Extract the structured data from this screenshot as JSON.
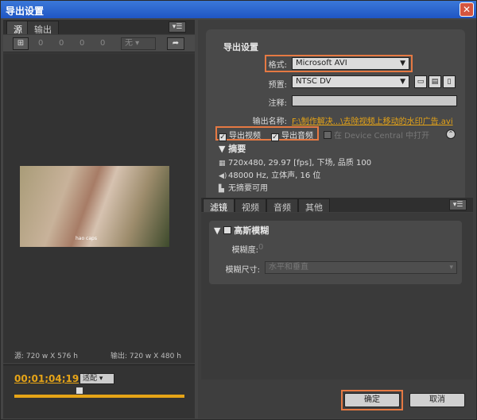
{
  "window": {
    "title": "导出设置",
    "close_glyph": "✕"
  },
  "left": {
    "tabs": [
      {
        "label": "源"
      },
      {
        "label": "输出"
      }
    ],
    "crop_values": [
      "0",
      "0",
      "0",
      "0"
    ],
    "crop_preset": "无",
    "source_size": "源: 720 w X 576 h",
    "output_size": "输出: 720 w X 480 h",
    "timecode": "00;01;04;19",
    "fit_label": "适配",
    "video_watermark_text": "hao caps"
  },
  "export": {
    "section_title": "导出设置",
    "format_label": "格式:",
    "format_value": "Microsoft AVI",
    "preset_label": "预置:",
    "preset_value": "NTSC DV",
    "note_label": "注释:",
    "note_value": "",
    "output_name_label": "输出名称:",
    "output_name_value": "F:\\制作解决...\\去除视频上移动的水印广告.avi",
    "export_video_label": "导出视频",
    "export_audio_label": "导出音频",
    "device_central_label": "在 Device Central 中打开",
    "summary_title": "摘要",
    "summary_lines": [
      {
        "icon": "film-icon",
        "text": "720x480, 29.97 [fps], 下场, 品质 100"
      },
      {
        "icon": "speaker-icon",
        "text": "48000 Hz, 立体声, 16 位"
      },
      {
        "icon": "chart-icon",
        "text": "无摘要可用"
      }
    ]
  },
  "tabs": [
    {
      "label": "滤镜"
    },
    {
      "label": "视频"
    },
    {
      "label": "音频"
    },
    {
      "label": "其他"
    }
  ],
  "filter": {
    "title": "高斯模糊",
    "blurriness_label": "模糊度:",
    "blurriness_value": "0",
    "dimension_label": "模糊尺寸:",
    "dimension_value": "水平和垂直"
  },
  "buttons": {
    "ok": "确定",
    "cancel": "取消"
  },
  "colors": {
    "accent": "#e6a417",
    "highlight": "#e57943"
  }
}
